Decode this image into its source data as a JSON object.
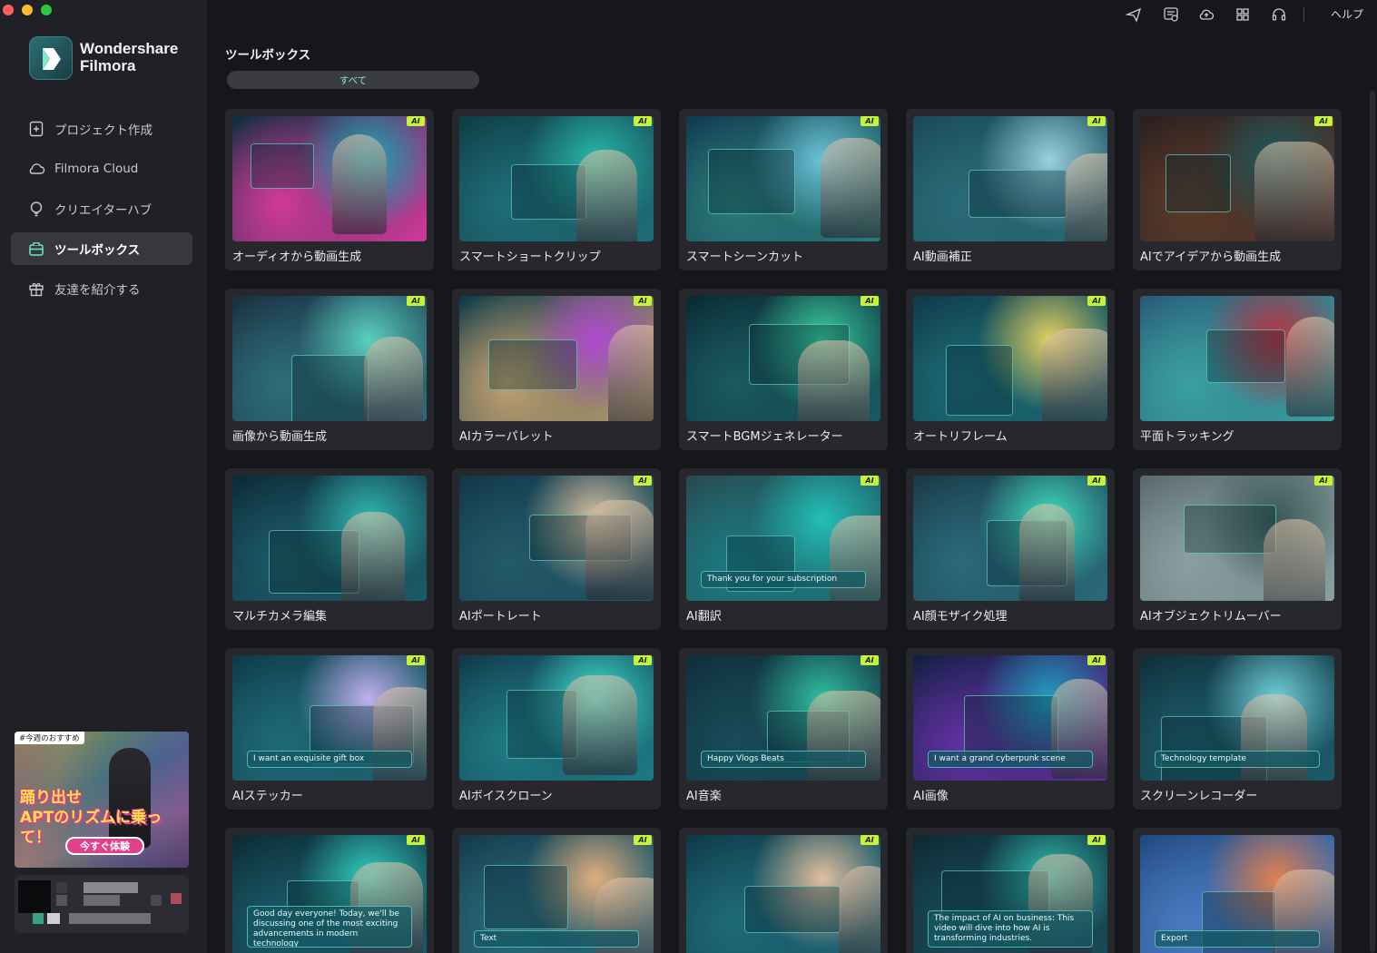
{
  "app": {
    "brand_line1": "Wondershare",
    "brand_line2": "Filmora"
  },
  "header": {
    "help_label": "ヘルプ",
    "icons": [
      "send-icon",
      "message-icon",
      "cloud-upload-icon",
      "grid-icon",
      "headset-icon"
    ]
  },
  "sidebar": {
    "items": [
      {
        "label": "プロジェクト作成",
        "icon": "plus-file-icon",
        "active": false
      },
      {
        "label": "Filmora Cloud",
        "icon": "cloud-icon",
        "active": false
      },
      {
        "label": "クリエイターハブ",
        "icon": "bulb-icon",
        "active": false
      },
      {
        "label": "ツールボックス",
        "icon": "toolbox-icon",
        "active": true
      },
      {
        "label": "友達を紹介する",
        "icon": "gift-icon",
        "active": false
      }
    ],
    "promo": {
      "badge": "#今週のおすすめ",
      "headline_line1": "踊り出せ",
      "headline_line2": "APTのリズムに乗って！",
      "cta": "今すぐ体験"
    }
  },
  "main": {
    "title": "ツールボックス",
    "filter_label": "すべて",
    "ai_badge": "AI",
    "tools": [
      {
        "label": "オーディオから動画生成",
        "ai": true,
        "theme": [
          "#0d2f3f",
          "#d03a9a",
          "#1aa8b8"
        ],
        "thumb_text": ""
      },
      {
        "label": "スマートショートクリップ",
        "ai": true,
        "theme": [
          "#0f3d44",
          "#1f6d78",
          "#27b8a8"
        ],
        "thumb_text": ""
      },
      {
        "label": "スマートシーンカット",
        "ai": true,
        "theme": [
          "#123a52",
          "#2a7a78",
          "#6ac4d8"
        ],
        "thumb_text": ""
      },
      {
        "label": "AI動画補正",
        "ai": true,
        "theme": [
          "#1a4a5a",
          "#2a6b78",
          "#9ad0e0"
        ],
        "thumb_text": ""
      },
      {
        "label": "AIでアイデアから動画生成",
        "ai": true,
        "theme": [
          "#2a2020",
          "#5a3a2a",
          "#1f5a60"
        ],
        "thumb_text": ""
      },
      {
        "label": "画像から動画生成",
        "ai": true,
        "theme": [
          "#1a3040",
          "#2d6d7a",
          "#5ad0c0"
        ],
        "thumb_text": ""
      },
      {
        "label": "AIカラーパレット",
        "ai": true,
        "theme": [
          "#0f3a48",
          "#c0a070",
          "#b04ad0"
        ],
        "thumb_text": ""
      },
      {
        "label": "スマートBGMジェネレーター",
        "ai": true,
        "theme": [
          "#0b2a34",
          "#1a5a60",
          "#3ad0a0"
        ],
        "thumb_text": ""
      },
      {
        "label": "オートリフレーム",
        "ai": true,
        "theme": [
          "#103a48",
          "#1c6a74",
          "#e0d060"
        ],
        "thumb_text": ""
      },
      {
        "label": "平面トラッキング",
        "ai": false,
        "theme": [
          "#2a5a78",
          "#3aa0a0",
          "#c03040"
        ],
        "thumb_text": ""
      },
      {
        "label": "マルチカメラ編集",
        "ai": false,
        "theme": [
          "#0d2a38",
          "#1d5a68",
          "#30b8b0"
        ],
        "thumb_text": ""
      },
      {
        "label": "AIポートレート",
        "ai": true,
        "theme": [
          "#123848",
          "#245a68",
          "#d8c0a0"
        ],
        "thumb_text": ""
      },
      {
        "label": "AI翻訳",
        "ai": true,
        "theme": [
          "#2a4a50",
          "#1a7a80",
          "#22c0b8"
        ],
        "thumb_text": "Thank you for your subscription"
      },
      {
        "label": "AI顔モザイク処理",
        "ai": true,
        "theme": [
          "#1a3a48",
          "#2a6a7a",
          "#40e0c0"
        ],
        "thumb_text": ""
      },
      {
        "label": "AIオブジェクトリムーバー",
        "ai": true,
        "theme": [
          "#5a6a70",
          "#8aa0a0",
          "#3a5a58"
        ],
        "thumb_text": ""
      },
      {
        "label": "AIステッカー",
        "ai": true,
        "theme": [
          "#0f3a48",
          "#1f6a78",
          "#c0b0f0"
        ],
        "thumb_text": "I want an exquisite gift box"
      },
      {
        "label": "AIボイスクローン",
        "ai": true,
        "theme": [
          "#123a4a",
          "#1f7a84",
          "#40e0d0"
        ],
        "thumb_text": ""
      },
      {
        "label": "AI音楽",
        "ai": true,
        "theme": [
          "#0f2f3a",
          "#1a4a58",
          "#30c0a0"
        ],
        "thumb_text": "Happy Vlogs Beats"
      },
      {
        "label": "AI画像",
        "ai": true,
        "theme": [
          "#102040",
          "#6030a0",
          "#20a0c0"
        ],
        "thumb_text": "I want a grand cyberpunk scene"
      },
      {
        "label": "スクリーンレコーダー",
        "ai": false,
        "theme": [
          "#0f2f3a",
          "#1d5a68",
          "#70d0d8"
        ],
        "thumb_text": "Technology template"
      },
      {
        "label": "",
        "ai": true,
        "theme": [
          "#0d2a34",
          "#1a5a68",
          "#30d0c0"
        ],
        "thumb_text": "Good day everyone! Today, we'll be discussing one of the most exciting advancements in modern technology"
      },
      {
        "label": "",
        "ai": true,
        "theme": [
          "#153a4a",
          "#2a6a7a",
          "#e0b080"
        ],
        "thumb_text": "Text"
      },
      {
        "label": "",
        "ai": true,
        "theme": [
          "#0f3a48",
          "#1f6a78",
          "#e0c0a0"
        ],
        "thumb_text": ""
      },
      {
        "label": "",
        "ai": true,
        "theme": [
          "#0d2a34",
          "#1a4a58",
          "#30c0b0"
        ],
        "thumb_text": "The impact of AI on business: This video will dive into how AI is transforming industries."
      },
      {
        "label": "",
        "ai": false,
        "theme": [
          "#204a80",
          "#4a7ac0",
          "#e08050"
        ],
        "thumb_text": "Export"
      }
    ]
  }
}
